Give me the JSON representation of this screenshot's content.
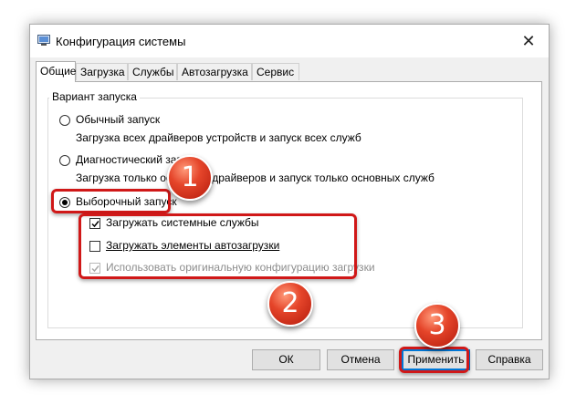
{
  "window": {
    "title": "Конфигурация системы",
    "close_symbol": "✕"
  },
  "tabs": [
    {
      "label": "Общие",
      "active": true
    },
    {
      "label": "Загрузка",
      "active": false
    },
    {
      "label": "Службы",
      "active": false
    },
    {
      "label": "Автозагрузка",
      "active": false
    },
    {
      "label": "Сервис",
      "active": false
    }
  ],
  "group": {
    "title": "Вариант запуска",
    "options": [
      {
        "label": "Обычный запуск",
        "description": "Загрузка всех драйверов устройств и запуск всех служб",
        "selected": false
      },
      {
        "label": "Диагностический запуск",
        "description": "Загрузка только основных драйверов и запуск только основных служб",
        "selected": false
      },
      {
        "label": "Выборочный запуск",
        "selected": true
      }
    ],
    "checkboxes": [
      {
        "label": "Загружать системные службы",
        "checked": true,
        "enabled": true
      },
      {
        "label": "Загружать элементы автозагрузки",
        "checked": false,
        "enabled": true
      },
      {
        "label": "Использовать оригинальную конфигурацию загрузки",
        "checked": true,
        "enabled": false
      }
    ]
  },
  "buttons": {
    "ok": "ОК",
    "cancel": "Отмена",
    "apply": "Применить",
    "help": "Справка"
  },
  "annotations": {
    "step1": "1",
    "step2": "2",
    "step3": "3",
    "highlight_color": "#d01818"
  }
}
